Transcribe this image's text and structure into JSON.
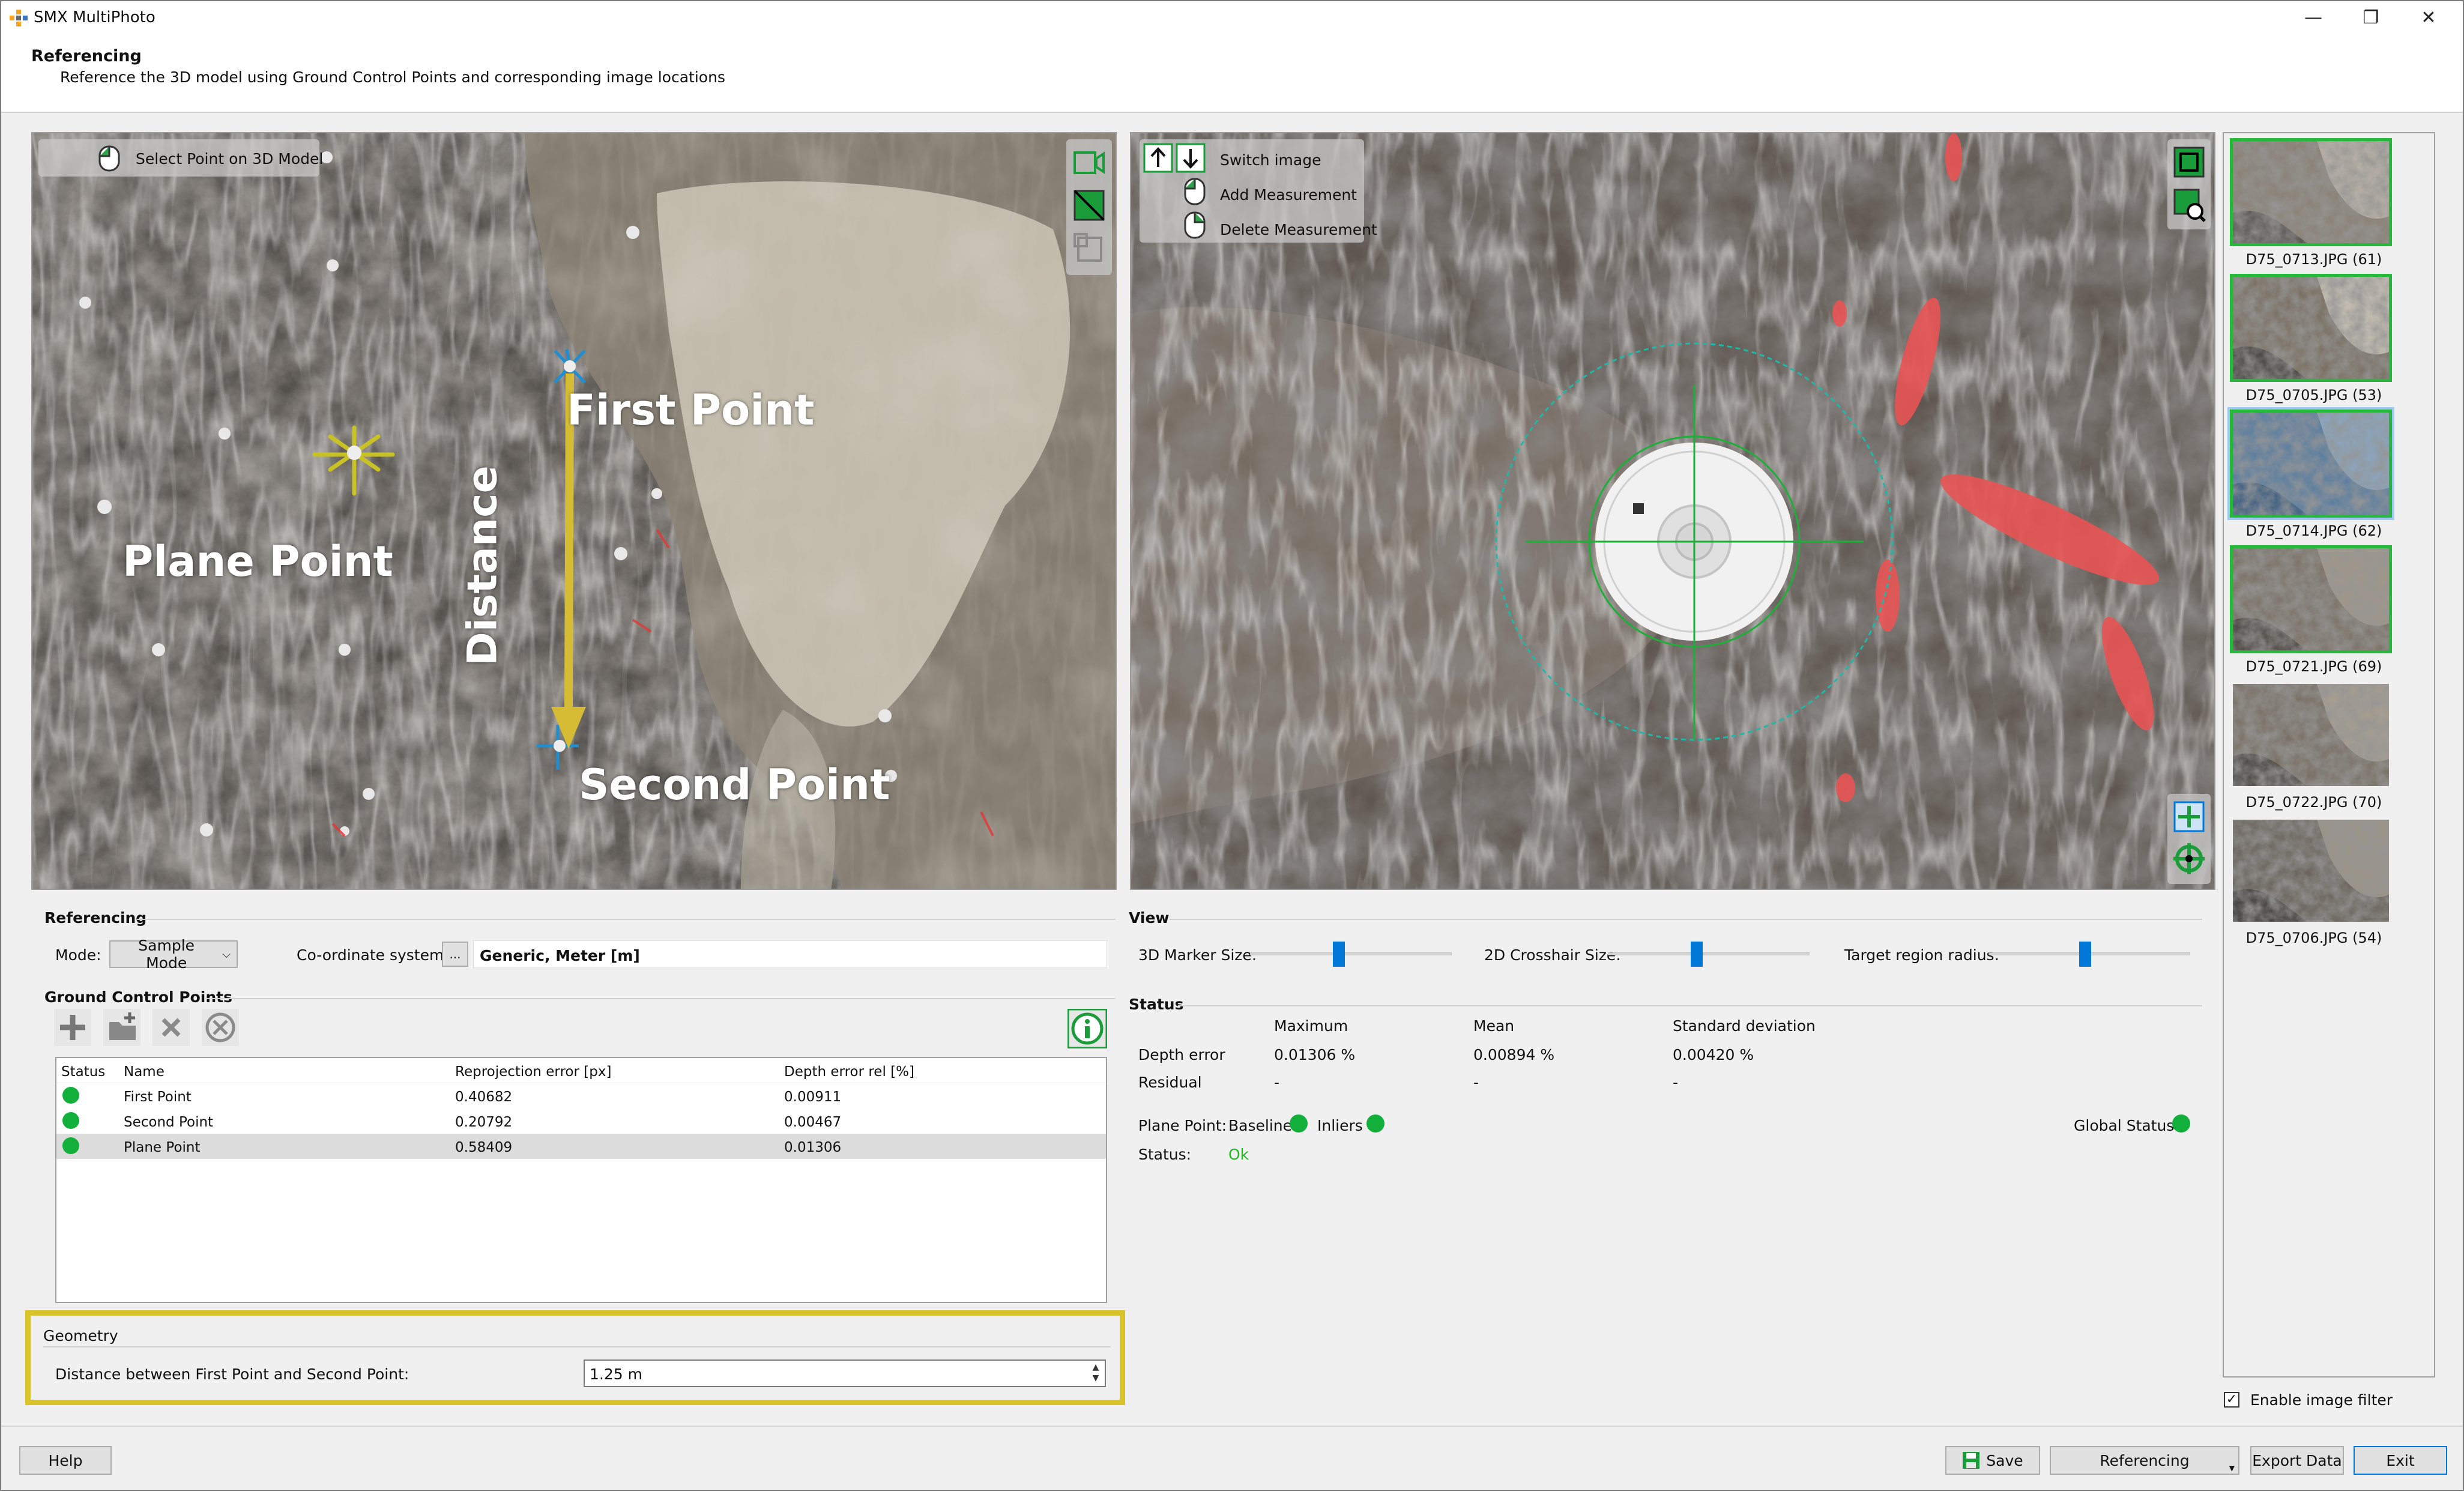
{
  "app": {
    "title": "SMX MultiPhoto"
  },
  "window_controls": {
    "minimize": "—",
    "restore": "❐",
    "close": "✕"
  },
  "header": {
    "title": "Referencing",
    "subtitle": "Reference the 3D model using Ground Control Points and corresponding image locations"
  },
  "model_view": {
    "select_point_label": "Select Point on 3D Model",
    "annotations": {
      "first_point": "First Point",
      "second_point": "Second Point",
      "plane_point": "Plane Point",
      "distance": "Distance"
    }
  },
  "image_view": {
    "switch_image": "Switch image",
    "add_measurement": "Add Measurement",
    "delete_measurement": "Delete Measurement"
  },
  "thumbnails": [
    {
      "label": "D75_0713.JPG (61)",
      "selected": true,
      "active": false
    },
    {
      "label": "D75_0705.JPG (53)",
      "selected": true,
      "active": false
    },
    {
      "label": "D75_0714.JPG (62)",
      "selected": true,
      "active": true
    },
    {
      "label": "D75_0721.JPG (69)",
      "selected": true,
      "active": false
    },
    {
      "label": "D75_0722.JPG (70)",
      "selected": false,
      "active": false
    },
    {
      "label": "D75_0706.JPG (54)",
      "selected": false,
      "active": false
    }
  ],
  "enable_image_filter": {
    "label": "Enable image filter",
    "checked": "✓"
  },
  "referencing": {
    "group_title": "Referencing",
    "mode_label": "Mode:",
    "mode_value": "Sample Mode",
    "coord_label": "Co-ordinate system:",
    "coord_button": "...",
    "coord_value": "Generic, Meter [m]"
  },
  "gcp": {
    "group_title": "Ground Control Points",
    "columns": [
      "Status",
      "Name",
      "Reprojection error [px]",
      "Depth error rel [%]"
    ],
    "rows": [
      {
        "name": "First Point",
        "reprojection": "0.40682",
        "depth": "0.00911"
      },
      {
        "name": "Second Point",
        "reprojection": "0.20792",
        "depth": "0.00467"
      },
      {
        "name": "Plane Point",
        "reprojection": "0.58409",
        "depth": "0.01306"
      }
    ]
  },
  "geometry": {
    "group_title": "Geometry",
    "distance_label": "Distance between First Point and Second Point:",
    "distance_value": "1.25 m"
  },
  "view": {
    "group_title": "View",
    "marker_size_label": "3D Marker Size:",
    "crosshair_size_label": "2D Crosshair Size:",
    "target_radius_label": "Target region radius:",
    "marker_size_level": 0.44,
    "crosshair_size_level": 0.44,
    "target_radius_level": 0.48
  },
  "status": {
    "group_title": "Status",
    "columns": [
      "Maximum",
      "Mean",
      "Standard deviation"
    ],
    "depth_error_label": "Depth error",
    "depth_error": [
      "0.01306 %",
      "0.00894 %",
      "0.00420 %"
    ],
    "residual_label": "Residual",
    "residual": [
      "-",
      "-",
      "-"
    ],
    "plane_point_label": "Plane Point:",
    "baseline_label": "Baseline",
    "inliers_label": "Inliers",
    "global_status_label": "Global Status",
    "status_label": "Status:",
    "status_value": "Ok"
  },
  "footer": {
    "help": "Help",
    "save": "Save",
    "referencing": "Referencing",
    "export": "Export Data",
    "exit": "Exit"
  },
  "colors": {
    "status_green": "#12b03a",
    "highlight_yellow": "#d8c42a",
    "accent_blue": "#0078d7",
    "ok_text": "#22b822"
  }
}
